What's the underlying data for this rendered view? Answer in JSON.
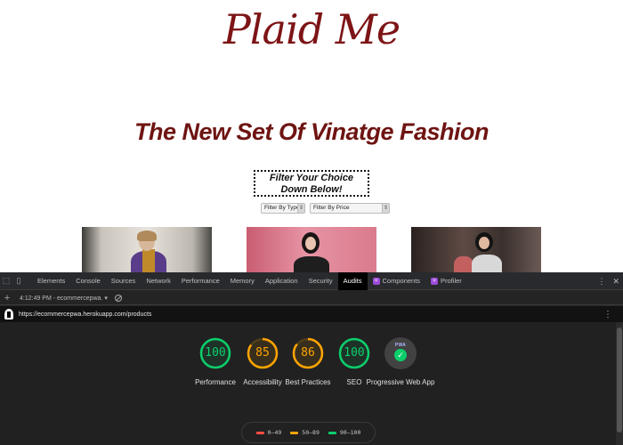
{
  "site": {
    "brand": "Plaid Me",
    "headline": "The New Set Of Vinatge Fashion",
    "filter_prompt": "Filter Your Choice Down Below!",
    "filter_type_label": "Filter By Type",
    "filter_price_label": "Filter By Price"
  },
  "devtools": {
    "tabs": [
      {
        "label": "Elements"
      },
      {
        "label": "Console"
      },
      {
        "label": "Sources"
      },
      {
        "label": "Network"
      },
      {
        "label": "Performance"
      },
      {
        "label": "Memory"
      },
      {
        "label": "Application"
      },
      {
        "label": "Security"
      },
      {
        "label": "Audits",
        "active": true
      },
      {
        "label": "Components"
      },
      {
        "label": "Profiler"
      }
    ],
    "session": "4:12:49 PM - ecommercepwa.",
    "url": "https://ecommercepwa.herokuapp.com/products"
  },
  "audits": {
    "colors": {
      "pass": "#0cce6b",
      "average": "#ffa400",
      "fail": "#ff4e42"
    },
    "gauges": [
      {
        "label": "Performance",
        "score": "100",
        "status": "pass"
      },
      {
        "label": "Accessibility",
        "score": "85",
        "status": "average"
      },
      {
        "label": "Best Practices",
        "score": "86",
        "status": "average"
      },
      {
        "label": "SEO",
        "score": "100",
        "status": "pass"
      }
    ],
    "pwa": {
      "label": "Progressive Web App",
      "badge_text": "PWA"
    },
    "legend": [
      {
        "range": "0–49",
        "status": "fail"
      },
      {
        "range": "50–89",
        "status": "average"
      },
      {
        "range": "90–100",
        "status": "pass"
      }
    ]
  }
}
